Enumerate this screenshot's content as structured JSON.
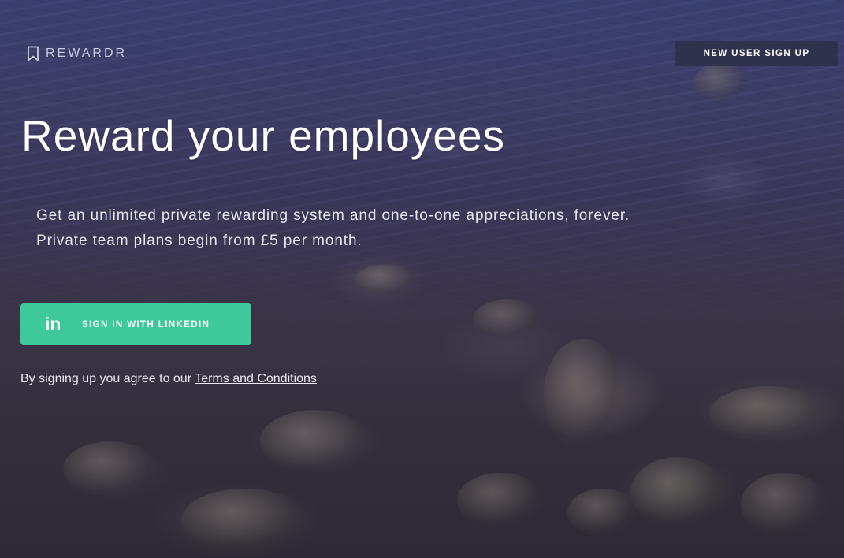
{
  "header": {
    "logo_text": "REWARDR",
    "logo_icon": "bookmark-icon",
    "signup_label": "NEW USER SIGN UP"
  },
  "hero": {
    "headline": "Reward your employees",
    "subtext_line1": "Get an unlimited private rewarding system and one-to-one appreciations, forever.",
    "subtext_line2": "Private team plans begin from £5 per month.",
    "linkedin_icon_text": "in",
    "linkedin_icon": "linkedin-icon",
    "linkedin_label": "SIGN IN WITH LINKEDIN",
    "terms_prefix": "By signing up you agree to our ",
    "terms_link": "Terms and Conditions"
  },
  "colors": {
    "accent": "#3ec99a",
    "signup_button_bg": "#2d3048"
  }
}
